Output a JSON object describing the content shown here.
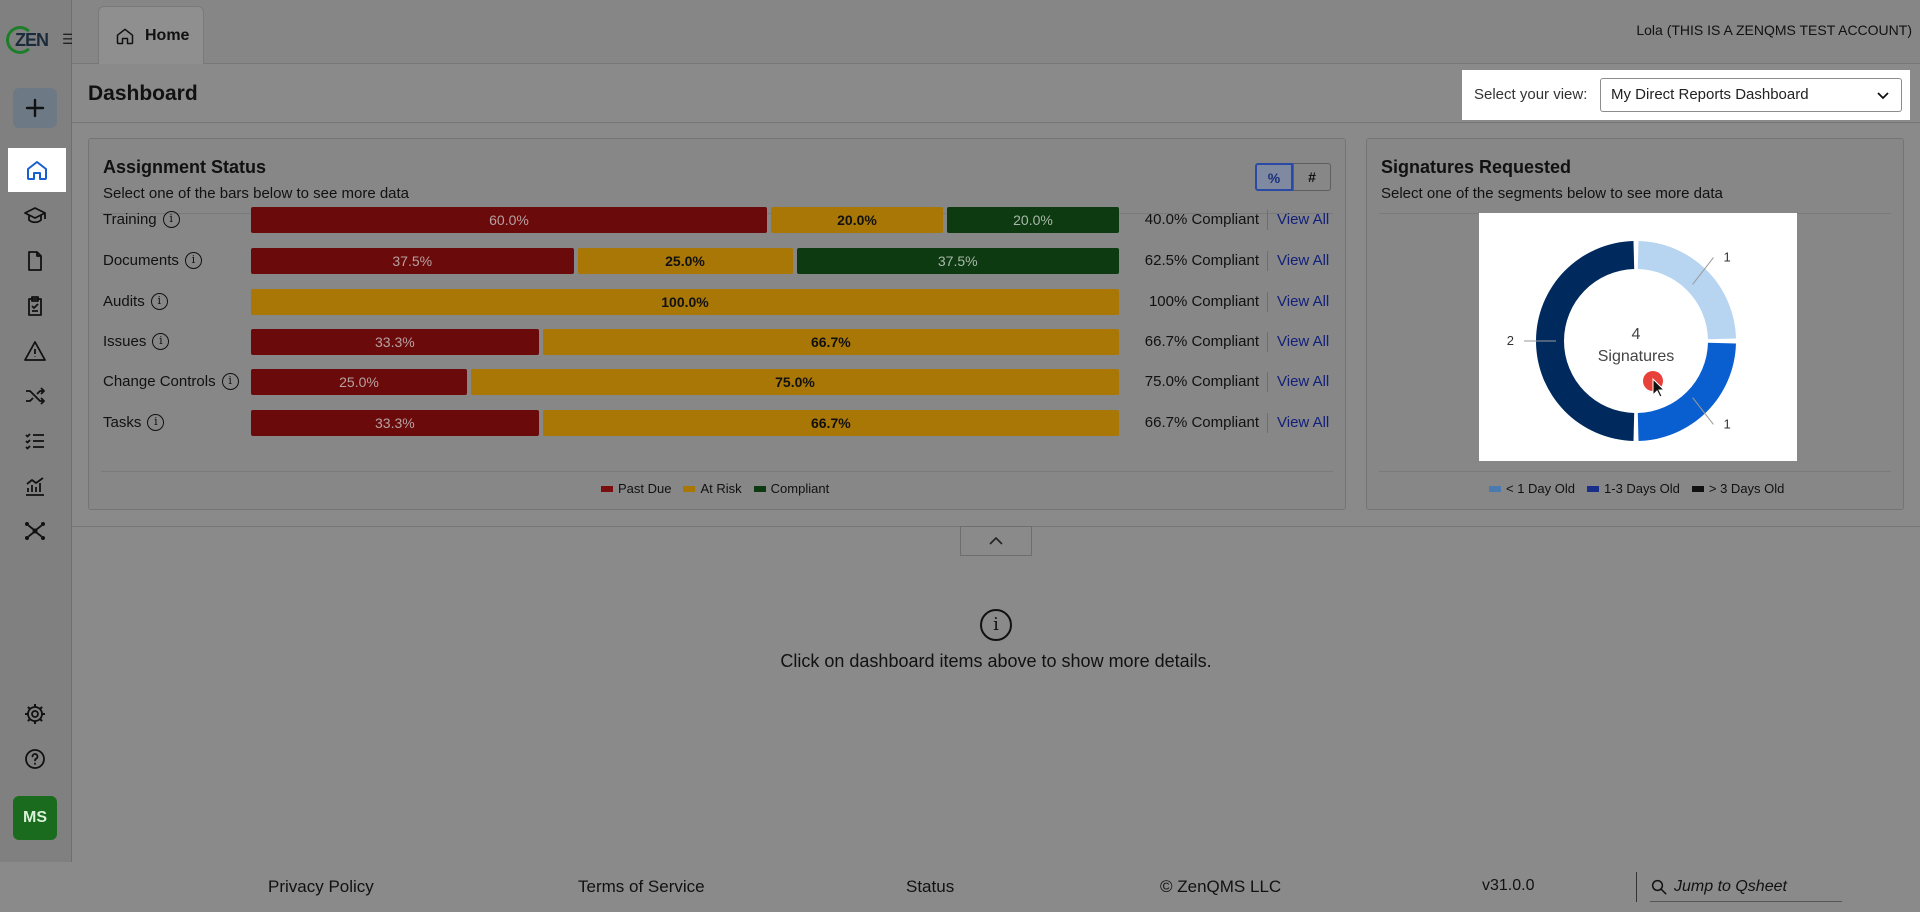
{
  "brand": {
    "logo_text": "ZEN",
    "logo_icon": "zen-logo"
  },
  "tabs": [
    {
      "label": "Home",
      "icon": "home-icon"
    }
  ],
  "user": {
    "name": "Lola (THIS IS A ZENQMS TEST ACCOUNT)",
    "initials": "MS"
  },
  "rail": [
    {
      "name": "add",
      "icon": "plus-icon"
    },
    {
      "name": "home",
      "icon": "home-icon",
      "active": true
    },
    {
      "name": "training",
      "icon": "graduation-cap-icon"
    },
    {
      "name": "documents",
      "icon": "document-icon"
    },
    {
      "name": "audits",
      "icon": "clipboard-check-icon"
    },
    {
      "name": "issues",
      "icon": "warning-icon"
    },
    {
      "name": "change-controls",
      "icon": "shuffle-icon"
    },
    {
      "name": "tasks",
      "icon": "checklist-icon"
    },
    {
      "name": "reports",
      "icon": "chart-icon"
    },
    {
      "name": "network",
      "icon": "network-icon"
    },
    {
      "name": "settings",
      "icon": "gear-icon"
    },
    {
      "name": "help",
      "icon": "help-icon"
    }
  ],
  "dashboard": {
    "title": "Dashboard",
    "view_label": "Select your view:",
    "view_value": "My Direct Reports Dashboard"
  },
  "assignment": {
    "title": "Assignment Status",
    "subtitle": "Select one of the bars below to see more data",
    "toggle_pct": "%",
    "toggle_num": "#",
    "view_all": "View All",
    "rows": [
      {
        "label": "Training",
        "past": 60.0,
        "risk": 20.0,
        "comp": 20.0,
        "past_label": "60.0%",
        "risk_label": "20.0%",
        "comp_label": "20.0%",
        "compliant": "40.0% Compliant"
      },
      {
        "label": "Documents",
        "past": 37.5,
        "risk": 25.0,
        "comp": 37.5,
        "past_label": "37.5%",
        "risk_label": "25.0%",
        "comp_label": "37.5%",
        "compliant": "62.5% Compliant"
      },
      {
        "label": "Audits",
        "past": 0,
        "risk": 100.0,
        "comp": 0,
        "past_label": "",
        "risk_label": "100.0%",
        "comp_label": "",
        "compliant": "100% Compliant"
      },
      {
        "label": "Issues",
        "past": 33.3,
        "risk": 66.7,
        "comp": 0,
        "past_label": "33.3%",
        "risk_label": "66.7%",
        "comp_label": "",
        "compliant": "66.7% Compliant"
      },
      {
        "label": "Change Controls",
        "past": 25.0,
        "risk": 75.0,
        "comp": 0,
        "past_label": "25.0%",
        "risk_label": "75.0%",
        "comp_label": "",
        "compliant": "75.0% Compliant"
      },
      {
        "label": "Tasks",
        "past": 33.3,
        "risk": 66.7,
        "comp": 0,
        "past_label": "33.3%",
        "risk_label": "66.7%",
        "comp_label": "",
        "compliant": "66.7% Compliant"
      }
    ],
    "legend": [
      {
        "label": "Past Due",
        "color": "#7a0d0d"
      },
      {
        "label": "At Risk",
        "color": "#a97705"
      },
      {
        "label": "Compliant",
        "color": "#0d3a10"
      }
    ]
  },
  "signatures": {
    "title": "Signatures Requested",
    "subtitle": "Select one of the segments below to see more data",
    "center_value": "4",
    "center_label": "Signatures",
    "legend": [
      {
        "label": "< 1 Day Old",
        "color": "#4a7bb0"
      },
      {
        "label": "1-3 Days Old",
        "color": "#1a2f8a"
      },
      {
        "label": "> 3 Days Old",
        "color": "#111111"
      }
    ]
  },
  "chart_data": {
    "type": "pie",
    "categories": [
      "< 1 Day Old",
      "1-3 Days Old",
      "> 3 Days Old"
    ],
    "values": [
      1,
      1,
      2
    ],
    "colors": [
      "#b7d4f0",
      "#0a5fd0",
      "#002a5e"
    ],
    "title": "Signatures Requested",
    "total": 4
  },
  "details": {
    "message": "Click on dashboard items above to show more details."
  },
  "footer": {
    "privacy": "Privacy Policy",
    "terms": "Terms of Service",
    "status": "Status",
    "copyright": "© ZenQMS LLC",
    "version": "v31.0.0",
    "jump_placeholder": "Jump to Qsheet"
  }
}
